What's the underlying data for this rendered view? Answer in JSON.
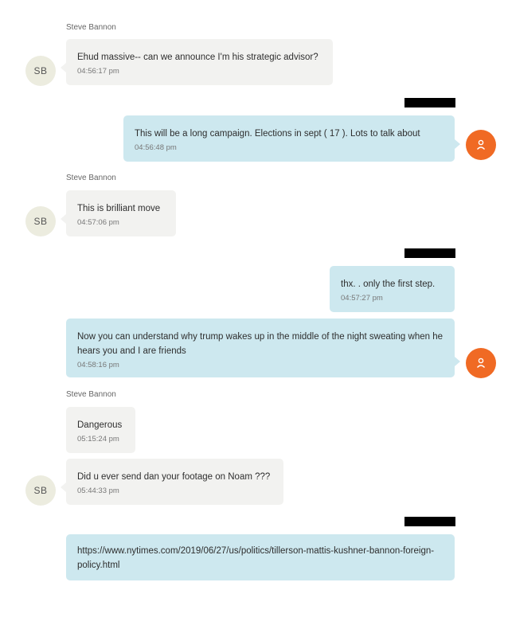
{
  "sender_name": "Steve Bannon",
  "sender_initials": "SB",
  "messages": [
    {
      "text": "Ehud massive-- can we announce I'm his strategic advisor?",
      "time": "04:56:17 pm"
    },
    {
      "text": "This will be a long campaign.  Elections in sept   ( 17 ).     Lots to talk about",
      "time": "04:56:48 pm"
    },
    {
      "text": "This is brilliant move",
      "time": "04:57:06 pm"
    },
    {
      "text": "thx.   . only the first step.",
      "time": "04:57:27 pm"
    },
    {
      "text": "Now you can understand why trump wakes up in the middle of the night sweating when he hears you and I are friends",
      "time": "04:58:16 pm"
    },
    {
      "text": "Dangerous",
      "time": "05:15:24 pm"
    },
    {
      "text": "Did u ever send dan your footage on Noam ???",
      "time": "05:44:33 pm"
    },
    {
      "text": "https://www.nytimes.com/2019/06/27/us/politics/tillerson-mattis-kushner-bannon-foreign-policy.html",
      "time": ""
    }
  ],
  "icons": {
    "user_avatar": "user-icon"
  },
  "colors": {
    "incoming_bubble": "#f2f2f0",
    "outgoing_bubble": "#cde8ef",
    "user_avatar": "#f06a24"
  }
}
